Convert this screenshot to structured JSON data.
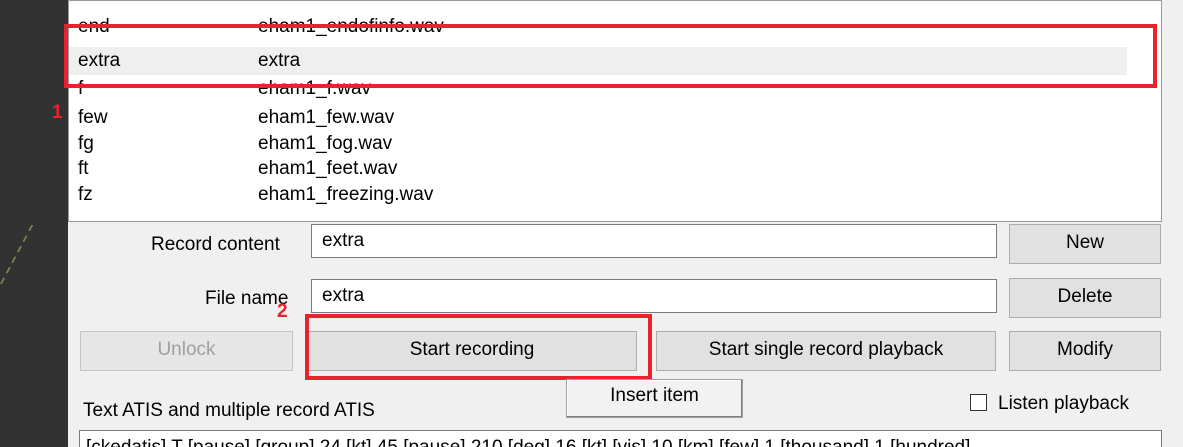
{
  "list": {
    "rows": [
      {
        "key": "end",
        "value": "eham1_endofinfo.wav"
      },
      {
        "key": "extra",
        "value": "extra"
      },
      {
        "key": "f",
        "value": "eham1_f.wav"
      },
      {
        "key": "few",
        "value": "eham1_few.wav"
      },
      {
        "key": "fg",
        "value": "eham1_fog.wav"
      },
      {
        "key": "ft",
        "value": "eham1_feet.wav"
      },
      {
        "key": "fz",
        "value": "eham1_freezing.wav"
      }
    ],
    "selected_key": "extra"
  },
  "form": {
    "record_content_label": "Record content",
    "record_content_value": "extra",
    "file_name_label": "File name",
    "file_name_value": "extra"
  },
  "buttons": {
    "new": "New",
    "delete": "Delete",
    "unlock": "Unlock",
    "start_recording": "Start recording",
    "start_single_playback": "Start single record playback",
    "modify": "Modify",
    "insert_item": "Insert item"
  },
  "atis": {
    "section_label": "Text ATIS and multiple record ATIS",
    "listen_playback_label": "Listen playback",
    "listen_playback_checked": false,
    "text": "[ckedatis] T [pause] [group] 24 [kt] 45 [pause] 210 [deg] 16 [kt] [vis] 10 [km] [few] 1 [thousand] 1 [hundred]"
  },
  "annotations": {
    "marker_1": "1",
    "marker_2": "2"
  },
  "colors": {
    "annotation": "#e8232e",
    "selected_row": "#efefef"
  }
}
